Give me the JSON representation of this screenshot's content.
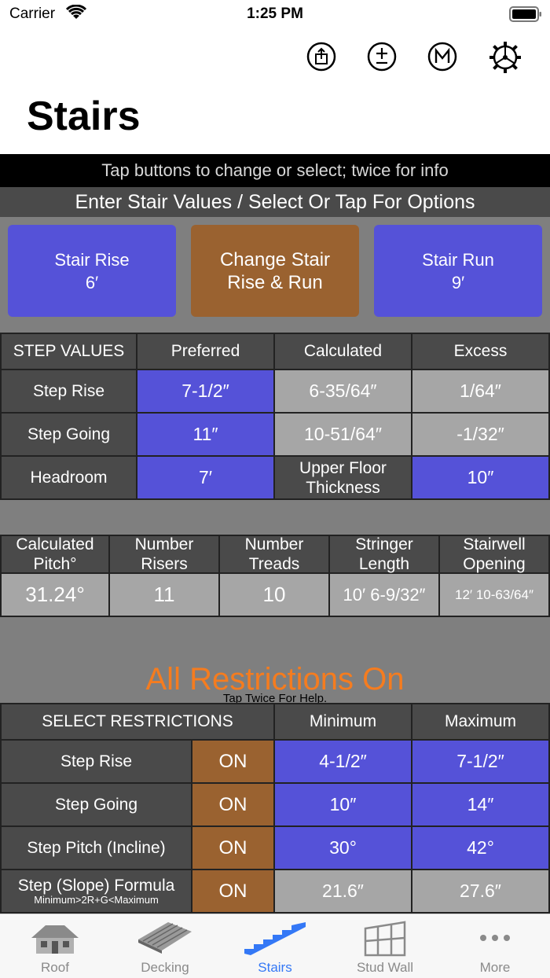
{
  "status_bar": {
    "carrier": "Carrier",
    "time": "1:25 PM"
  },
  "nav": {
    "title": "Stairs",
    "icons": [
      "share-icon",
      "plus-minus-icon",
      "m-circle-icon",
      "gear-icon"
    ]
  },
  "hint": "Tap buttons to change or select; twice for info",
  "enter_header": "Enter Stair Values / Select Or Tap For Options",
  "buttons": {
    "stair_rise": {
      "label": "Stair Rise",
      "value": "6′"
    },
    "change": {
      "line1": "Change Stair",
      "line2": "Rise & Run"
    },
    "stair_run": {
      "label": "Stair Run",
      "value": "9′"
    }
  },
  "step_table": {
    "headers": [
      "STEP VALUES",
      "Preferred",
      "Calculated",
      "Excess"
    ],
    "step_rise": {
      "label": "Step Rise",
      "preferred": "7-1/2″",
      "calculated": "6-35/64″",
      "excess": "1/64″"
    },
    "step_going": {
      "label": "Step Going",
      "preferred": "11″",
      "calculated": "10-51/64″",
      "excess": "-1/32″"
    },
    "headroom": {
      "label": "Headroom",
      "preferred": "7′",
      "upper_label1": "Upper Floor",
      "upper_label2": "Thickness",
      "upper_value": "10″"
    }
  },
  "results": {
    "headers": [
      {
        "l1": "Calculated",
        "l2": "Pitch°"
      },
      {
        "l1": "Number",
        "l2": "Risers"
      },
      {
        "l1": "Number",
        "l2": "Treads"
      },
      {
        "l1": "Stringer",
        "l2": "Length"
      },
      {
        "l1": "Stairwell",
        "l2": "Opening"
      }
    ],
    "values": [
      "31.24°",
      "11",
      "10",
      "10′ 6-9/32″",
      "12′ 10-63/64″"
    ]
  },
  "restrictions": {
    "title": "All Restrictions On",
    "help": "Tap Twice For Help.",
    "headers": [
      "SELECT RESTRICTIONS",
      "Minimum",
      "Maximum"
    ],
    "rows": [
      {
        "label": "Step Rise",
        "toggle": "ON",
        "min": "4-1/2″",
        "max": "7-1/2″"
      },
      {
        "label": "Step Going",
        "toggle": "ON",
        "min": "10″",
        "max": "14″"
      },
      {
        "label": "Step Pitch (Incline)",
        "toggle": "ON",
        "min": "30°",
        "max": "42°"
      },
      {
        "label": "Step (Slope) Formula",
        "sublabel": "Minimum>2R+G<Maximum",
        "toggle": "ON",
        "min": "21.6″",
        "max": "27.6″"
      }
    ]
  },
  "tabs": [
    {
      "label": "Roof",
      "icon": "house-icon"
    },
    {
      "label": "Decking",
      "icon": "decking-icon"
    },
    {
      "label": "Stairs",
      "icon": "stairs-icon"
    },
    {
      "label": "Stud Wall",
      "icon": "stud-wall-icon"
    },
    {
      "label": "More",
      "icon": "more-icon"
    }
  ],
  "colors": {
    "blue": "#5552d8",
    "brown": "#9a6230",
    "orange": "#f57c1f",
    "active_tab": "#3478f6"
  }
}
